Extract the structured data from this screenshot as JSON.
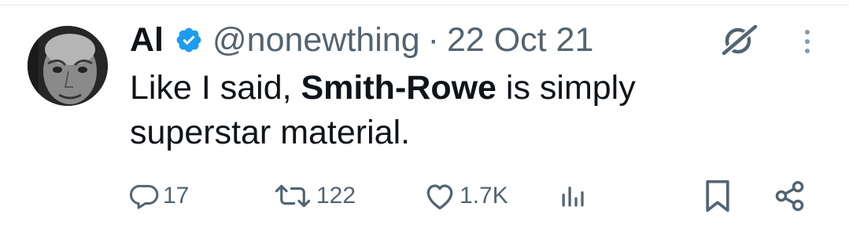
{
  "tweet": {
    "author": {
      "display_name": "Al",
      "handle": "@nonewthing",
      "verified": true
    },
    "separator": "·",
    "date": "22 Oct 21",
    "text": {
      "part1": "Like I said, ",
      "bold": "Smith-Rowe",
      "part2": " is simply superstar material."
    }
  },
  "actions": {
    "reply_count": "17",
    "retweet_count": "122",
    "like_count": "1.7K"
  },
  "icons": {
    "verified": "verified-badge-icon",
    "grok": "grok-icon",
    "more": "more-vertical-icon",
    "reply": "reply-icon",
    "retweet": "retweet-icon",
    "like": "heart-icon",
    "views": "views-icon",
    "bookmark": "bookmark-icon",
    "share": "share-icon"
  },
  "colors": {
    "text": "#0f1419",
    "secondary": "#536471",
    "verified": "#1d9bf0"
  }
}
